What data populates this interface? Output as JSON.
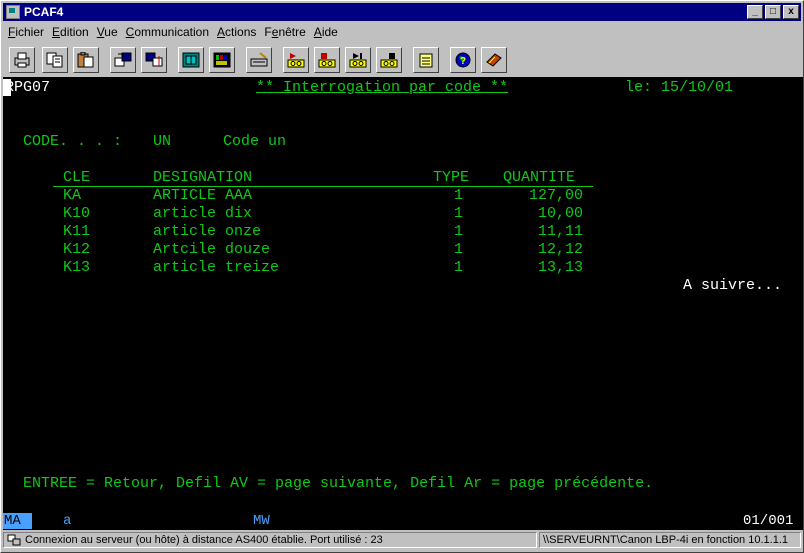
{
  "window": {
    "title": "PCAF4"
  },
  "title_buttons": {
    "minimize": "_",
    "maximize": "□",
    "close": "x"
  },
  "menu": [
    {
      "label": "Fichier",
      "ul": "F",
      "rest": "ichier"
    },
    {
      "label": "Edition",
      "ul": "E",
      "rest": "dition"
    },
    {
      "label": "Vue",
      "ul": "V",
      "rest": "ue"
    },
    {
      "label": "Communication",
      "ul": "C",
      "rest": "ommunication"
    },
    {
      "label": "Actions",
      "ul": "A",
      "rest": "ctions"
    },
    {
      "label": "Fenêtre",
      "ul": "e",
      "prefix": "F",
      "rest": "nêtre"
    },
    {
      "label": "Aide",
      "ul": "A",
      "rest": "ide"
    }
  ],
  "toolbar": {
    "icons": [
      "print-icon",
      "copy-icon",
      "paste-icon",
      "send-file-icon",
      "receive-file-icon",
      "display-setup-icon",
      "color-palette-icon",
      "keyboard-setup-icon",
      "macro-record-icon",
      "macro-stop-icon",
      "macro-play-icon",
      "macro-pause-icon",
      "clipboard-icon",
      "globe-help-icon",
      "index-book-icon"
    ]
  },
  "screen": {
    "program": "RPG07",
    "title": "** Interrogation par code **",
    "date": "le: 15/10/01",
    "code_label": "CODE. . . :",
    "code_value": "UN",
    "code_desc": "Code un",
    "columns": {
      "cle": "CLE",
      "designation": "DESIGNATION",
      "type": "TYPE",
      "quantite": "QUANTITE"
    },
    "rows": [
      {
        "cle": "KA",
        "designation": "ARTICLE AAA",
        "type": "1",
        "quantite": "127,00"
      },
      {
        "cle": "K10",
        "designation": "article dix",
        "type": "1",
        "quantite": "10,00"
      },
      {
        "cle": "K11",
        "designation": "article onze",
        "type": "1",
        "quantite": "11,11"
      },
      {
        "cle": "K12",
        "designation": "Artcile douze",
        "type": "1",
        "quantite": "12,12"
      },
      {
        "cle": "K13",
        "designation": "article treize",
        "type": "1",
        "quantite": "13,13"
      }
    ],
    "more": "A suivre...",
    "footer": "ENTREE = Retour, Defil AV = page suivante, Defil Ar = page précédente."
  },
  "oia": {
    "ma": "MA",
    "a": "a",
    "mw": "MW",
    "position": "01/001"
  },
  "status": {
    "connection": "Connexion au serveur (ou hôte) à distance AS400 établie. Port utilisé : 23",
    "printer": "\\\\SERVEURNT\\Canon LBP-4i en fonction 10.1.1.1"
  }
}
